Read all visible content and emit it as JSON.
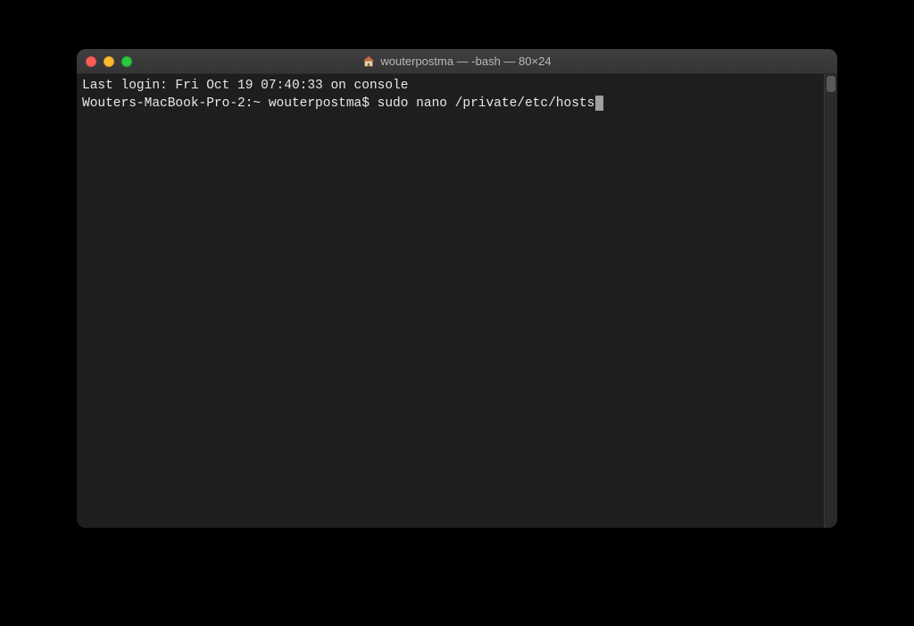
{
  "window": {
    "title": "wouterpostma — -bash — 80×24"
  },
  "terminal": {
    "login_line": "Last login: Fri Oct 19 07:40:33 on console",
    "prompt_host": "Wouters-MacBook-Pro-2:~ wouterpostma$ ",
    "command": "sudo nano /private/etc/hosts"
  }
}
